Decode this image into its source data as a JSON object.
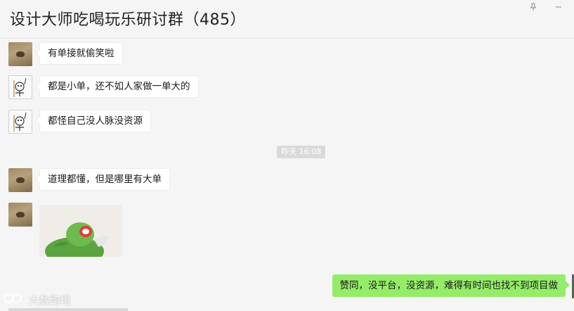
{
  "window": {
    "title": "设计大师吃喝玩乐研讨群（485）",
    "pin_icon": "pin-icon",
    "minimize_icon": "minimize-icon"
  },
  "messages": [
    {
      "side": "left",
      "avatar": "ground-photo",
      "text": "有单接就偷笑啦"
    },
    {
      "side": "left",
      "avatar": "doodle-figure",
      "text": "都是小单，还不如人家做一单大的"
    },
    {
      "side": "left",
      "avatar": "doodle-figure",
      "text": "都怪自己没人脉没资源"
    },
    {
      "type": "time",
      "text": "昨天 16:08"
    },
    {
      "side": "left",
      "avatar": "ground-photo",
      "text": "道理都懂，但是哪里有大单"
    },
    {
      "side": "left",
      "avatar": "ground-photo",
      "type": "sticker",
      "sticker": "kermit-frog-sticker"
    },
    {
      "side": "right",
      "text": "赞同，没平台，没资源，难得有时间也找不到项目做"
    }
  ],
  "watermark": {
    "text": "大数跨境"
  },
  "colors": {
    "background": "#f5f5f5",
    "incoming_bubble": "#ffffff",
    "outgoing_bubble": "#95ec69",
    "time_chip": "#dadada"
  }
}
